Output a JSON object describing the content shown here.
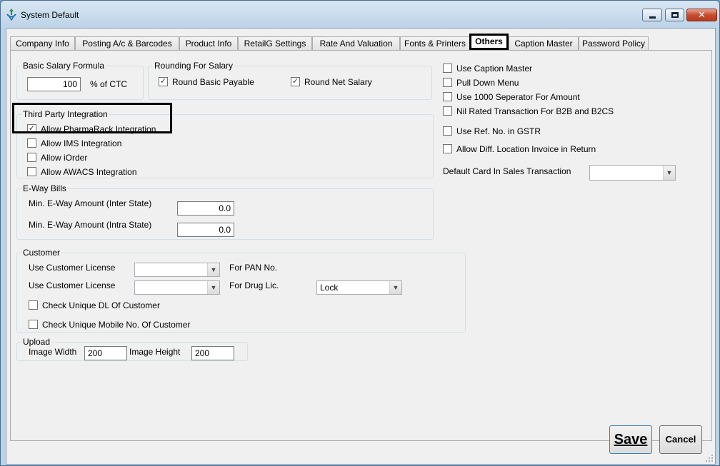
{
  "window": {
    "title": "System Default"
  },
  "tabs": [
    {
      "label": "Company Info",
      "active": false
    },
    {
      "label": "Posting A/c & Barcodes",
      "active": false
    },
    {
      "label": "Product Info",
      "active": false
    },
    {
      "label": "RetailG Settings",
      "active": false
    },
    {
      "label": "Rate And Valuation",
      "active": false
    },
    {
      "label": "Fonts & Printers",
      "active": false
    },
    {
      "label": "Others",
      "active": true
    },
    {
      "label": "Caption Master",
      "active": false
    },
    {
      "label": "Password Policy",
      "active": false
    }
  ],
  "basic_salary": {
    "title": "Basic Salary Formula",
    "value": "100",
    "suffix": "% of CTC"
  },
  "rounding": {
    "title": "Rounding For Salary",
    "round_basic": {
      "label": "Round Basic Payable",
      "checked": true
    },
    "round_net": {
      "label": "Round Net Salary",
      "checked": true
    }
  },
  "third_party": {
    "title": "Third Party Integration",
    "items": [
      {
        "label": "Allow PharmaRack Integration",
        "checked": true
      },
      {
        "label": "Allow IMS Integration",
        "checked": false
      },
      {
        "label": "Allow iOrder",
        "checked": false
      },
      {
        "label": "Allow AWACS Integration",
        "checked": false
      }
    ]
  },
  "eway": {
    "title": "E-Way Bills",
    "inter_label": "Min. E-Way Amount (Inter State)",
    "inter_value": "0.0",
    "intra_label": "Min. E-Way Amount (Intra State)",
    "intra_value": "0.0"
  },
  "customer": {
    "title": "Customer",
    "license_pan_label": "Use Customer License",
    "license_pan_suffix": "For PAN No.",
    "license_pan_value": "",
    "license_drug_label": "Use Customer License",
    "license_drug_suffix": "For Drug Lic.",
    "license_drug_value": "",
    "drug_lock_value": "Lock",
    "unique_dl": {
      "label": "Check Unique DL Of Customer",
      "checked": false
    },
    "unique_mobile": {
      "label": "Check Unique Mobile No. Of Customer",
      "checked": false
    }
  },
  "upload": {
    "title": "Upload",
    "width_label": "Image Width",
    "width_value": "200",
    "height_label": "Image Height",
    "height_value": "200"
  },
  "right_options": [
    {
      "label": "Use Caption Master",
      "checked": false
    },
    {
      "label": "Pull Down Menu",
      "checked": false
    },
    {
      "label": "Use 1000 Seperator For Amount",
      "checked": false
    },
    {
      "label": "Nil Rated Transaction For B2B and B2CS",
      "checked": false
    },
    {
      "label": "Use Ref. No. in GSTR",
      "checked": false
    },
    {
      "label": "Allow Diff. Location Invoice in Return",
      "checked": false
    }
  ],
  "default_card": {
    "label": "Default Card In Sales Transaction",
    "value": ""
  },
  "buttons": {
    "save_label": "Save",
    "cancel_label": "Cancel"
  },
  "colors": {
    "title_bar": "#bdd3e8",
    "close_button": "#c64c2f",
    "panel": "#f0f0f0",
    "highlight": "#000000"
  }
}
